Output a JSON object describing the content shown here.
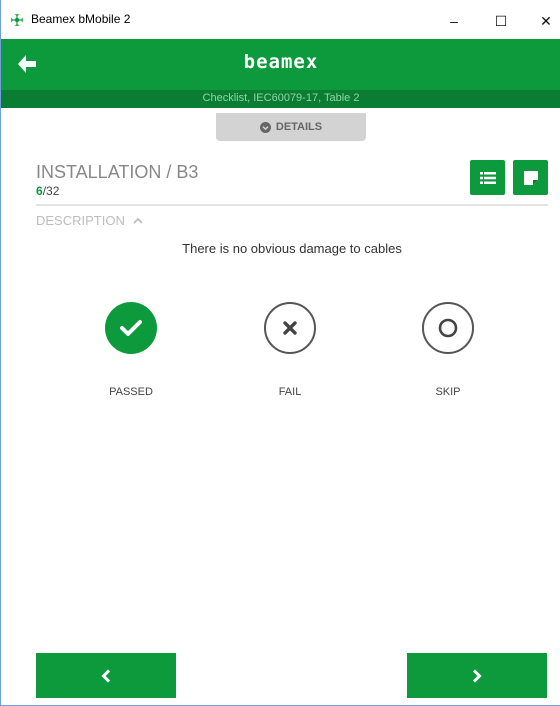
{
  "window": {
    "title": "Beamex bMobile 2",
    "minimize_label": "–",
    "maximize_label": "☐",
    "close_label": "✕",
    "app_icon": "beamex-app-icon"
  },
  "header": {
    "logo_text": "beamex",
    "back_icon": "arrow-left-icon",
    "subtitle": "Checklist, IEC60079-17, Table 2",
    "accent_color": "#0c9a3d"
  },
  "details_tab": {
    "label": "DETAILS",
    "icon": "chevron-circle-down-icon"
  },
  "section": {
    "title": "INSTALLATION / B3",
    "current": "6",
    "separator_total": "/32",
    "list_icon": "list-icon",
    "note_icon": "note-icon"
  },
  "description": {
    "label": "DESCRIPTION",
    "toggle_icon": "chevron-up-icon",
    "text": "There is no obvious damage to cables"
  },
  "choices": [
    {
      "label": "PASSED",
      "icon": "check-icon",
      "selected": true
    },
    {
      "label": "FAIL",
      "icon": "x-icon",
      "selected": false
    },
    {
      "label": "SKIP",
      "icon": "circle-icon",
      "selected": false
    }
  ],
  "navigation": {
    "prev_icon": "chevron-left-icon",
    "next_icon": "chevron-right-icon"
  }
}
